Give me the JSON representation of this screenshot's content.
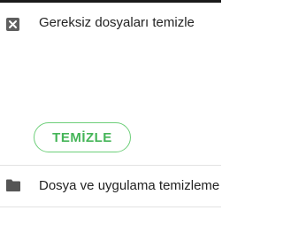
{
  "header": {
    "title": "Gereksiz dosyaları temizle",
    "close_icon": "close-box-icon"
  },
  "clean_button": {
    "label": "TEMİZLE",
    "color": "#45b558",
    "border_color": "#6ecf7a"
  },
  "list": {
    "items": [
      {
        "label": "Dosya ve uygulama temizleme",
        "icon": "folder-icon"
      }
    ]
  }
}
